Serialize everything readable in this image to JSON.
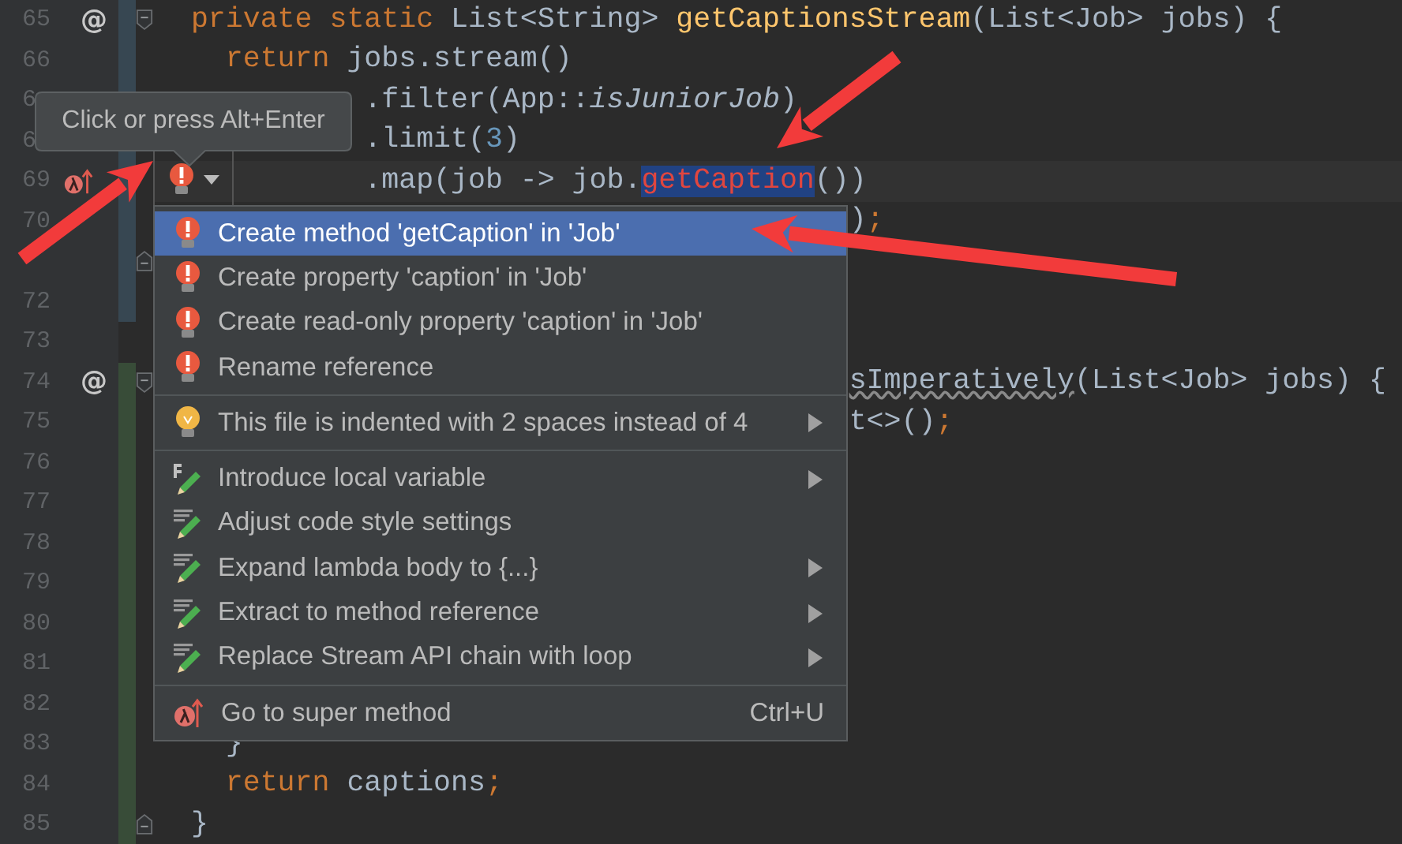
{
  "editor": {
    "lines": [
      {
        "number": "65",
        "color": "#374752",
        "mark": "@",
        "fold_start": true,
        "tokens": [
          {
            "t": "  private static",
            "kind": "kw"
          },
          {
            "t": " List<String> ",
            "kind": "plain"
          },
          {
            "t": "getCaptionsStream",
            "kind": "decl"
          },
          {
            "t": "(List<Job> jobs) {",
            "kind": "plain"
          }
        ]
      },
      {
        "number": "66",
        "color": "#374752",
        "tokens": [
          {
            "t": "    return",
            "kind": "kw"
          },
          {
            "t": " jobs.stream()",
            "kind": "plain"
          }
        ]
      },
      {
        "number": "6",
        "color": "#374752",
        "tokens": [
          {
            "t": "            .filter(App::",
            "kind": "plain"
          },
          {
            "t": "isJuniorJob",
            "kind": "static"
          },
          {
            "t": ")",
            "kind": "plain"
          }
        ]
      },
      {
        "number": "6",
        "color": "#374752",
        "tokens": [
          {
            "t": "            .limit(",
            "kind": "plain"
          },
          {
            "t": "3",
            "kind": "num"
          },
          {
            "t": ")",
            "kind": "plain"
          }
        ]
      },
      {
        "number": "69",
        "color": "#374752",
        "super_marker": true,
        "current": true,
        "bulb": true,
        "tokens": [
          {
            "t": "            .map(job -> job.",
            "kind": "plain"
          },
          {
            "t": "getCaption",
            "kind": "error"
          },
          {
            "t": "())",
            "kind": "plain"
          }
        ]
      },
      {
        "number": "70",
        "color": "#374752",
        "tokens": [
          {
            "t": "                                        )",
            "kind": "plain"
          },
          {
            "t": ";",
            "kind": "kw"
          }
        ]
      },
      {
        "color": "#374752",
        "fold_end": true
      },
      {
        "number": "72",
        "color": "#374752"
      },
      {
        "number": "73"
      },
      {
        "number": "74",
        "color": "#384c38",
        "mark": "@",
        "fold_start": true,
        "tokens": [
          {
            "t": "                                        sImperatively",
            "kind": "warn"
          },
          {
            "t": "(List<Job> jobs) {",
            "kind": "plain"
          }
        ]
      },
      {
        "number": "75",
        "color": "#384c38",
        "tokens": [
          {
            "t": "                                        t<>()",
            "kind": "plain"
          },
          {
            "t": ";",
            "kind": "kw"
          }
        ]
      },
      {
        "number": "76",
        "color": "#384c38"
      },
      {
        "number": "77",
        "color": "#384c38"
      },
      {
        "number": "78",
        "color": "#384c38"
      },
      {
        "number": "79",
        "color": "#384c38"
      },
      {
        "number": "80",
        "color": "#384c38"
      },
      {
        "number": "81",
        "color": "#384c38"
      },
      {
        "number": "82",
        "color": "#384c38"
      },
      {
        "number": "83",
        "color": "#384c38",
        "tokens": [
          {
            "t": "    }",
            "kind": "plain"
          }
        ]
      },
      {
        "number": "84",
        "color": "#384c38",
        "tokens": [
          {
            "t": "    return",
            "kind": "kw"
          },
          {
            "t": " captions",
            "kind": "plain"
          },
          {
            "t": ";",
            "kind": "kw"
          }
        ]
      },
      {
        "number": "85",
        "color": "#384c38",
        "fold_end": true,
        "tokens": [
          {
            "t": "  }",
            "kind": "plain"
          }
        ]
      }
    ]
  },
  "tooltip": {
    "text": "Click or press Alt+Enter"
  },
  "popup": {
    "groups": [
      [
        {
          "label": "Create method 'getCaption' in 'Job'",
          "kind": "error",
          "selected": true,
          "submenu": false
        },
        {
          "label": "Create property 'caption' in 'Job'",
          "kind": "error",
          "selected": false,
          "submenu": false
        },
        {
          "label": "Create read-only property 'caption' in 'Job'",
          "kind": "error",
          "selected": false,
          "submenu": false
        },
        {
          "label": "Rename reference",
          "kind": "error",
          "selected": false,
          "submenu": false
        }
      ],
      [
        {
          "label": "This file is indented with 2 spaces instead of 4",
          "kind": "bulb",
          "selected": false,
          "submenu": true
        }
      ],
      [
        {
          "label": "Introduce local variable",
          "kind": "refactor",
          "selected": false,
          "submenu": true
        },
        {
          "label": "Adjust code style settings",
          "kind": "intention",
          "selected": false,
          "submenu": false
        },
        {
          "label": "Expand lambda body to {...}",
          "kind": "intention",
          "selected": false,
          "submenu": true
        },
        {
          "label": "Extract to method reference",
          "kind": "intention",
          "selected": false,
          "submenu": true
        },
        {
          "label": "Replace Stream API chain with loop",
          "kind": "intention",
          "selected": false,
          "submenu": true
        }
      ],
      [
        {
          "label": "Go to super method",
          "kind": "super",
          "selected": false,
          "submenu": false,
          "shortcut": "Ctrl+U"
        }
      ]
    ]
  }
}
